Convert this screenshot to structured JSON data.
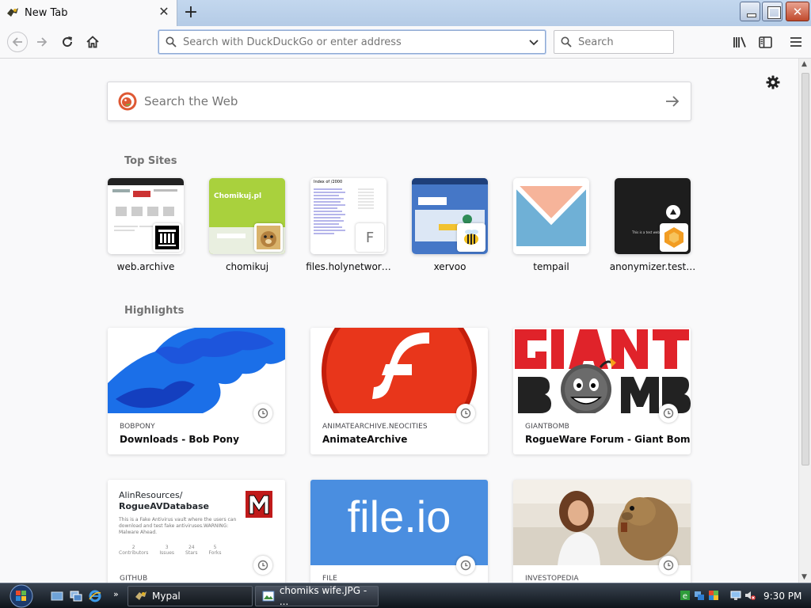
{
  "browser": {
    "tab": {
      "title": "New Tab"
    },
    "urlbar": {
      "placeholder": "Search with DuckDuckGo or enter address"
    },
    "searchbar": {
      "placeholder": "Search"
    }
  },
  "newtab": {
    "web_search": {
      "placeholder": "Search the Web"
    },
    "top_sites": {
      "title": "Top Sites",
      "items": [
        {
          "label": "web.archive",
          "favicon_letter": ""
        },
        {
          "label": "chomikuj",
          "favicon_letter": ""
        },
        {
          "label": "files.holynetwor…",
          "favicon_letter": "F"
        },
        {
          "label": "xervoo",
          "favicon_letter": ""
        },
        {
          "label": "tempail",
          "favicon_letter": ""
        },
        {
          "label": "anonymizer.test…",
          "favicon_letter": ""
        }
      ]
    },
    "highlights": {
      "title": "Highlights",
      "cards": [
        {
          "host": "BOBPONY",
          "title": "Downloads - Bob Pony"
        },
        {
          "host": "ANIMATEARCHIVE.NEOCITIES",
          "title": "AnimateArchive"
        },
        {
          "host": "GIANTBOMB",
          "title": "RogueWare Forum - Giant Bomb"
        },
        {
          "host": "GITHUB",
          "title": "",
          "preview": {
            "heading_line1": "AlinResources/",
            "heading_line2": "RogueAVDatabase",
            "body": "This is a Fake Antivirus vault where the users can download and test fake antiviruses.WARNING: Malware Ahead.",
            "stats": [
              {
                "value": "2",
                "label": "Contributors"
              },
              {
                "value": "3",
                "label": "Issues"
              },
              {
                "value": "24",
                "label": "Stars"
              },
              {
                "value": "5",
                "label": "Forks"
              }
            ]
          }
        },
        {
          "host": "FILE",
          "title": "",
          "preview": {
            "text": "file.io"
          }
        },
        {
          "host": "INVESTOPEDIA",
          "title": ""
        }
      ]
    },
    "thumb_text": {
      "chomikuj_logo": "Chomikuj.pl",
      "archive_header": "Index of /2000",
      "anonymizer_caption": "This is a test website"
    }
  },
  "taskbar": {
    "tasks": [
      {
        "label": "Mypal"
      },
      {
        "label": "chomiks wife.JPG - ..."
      }
    ],
    "clock": "9:30 PM"
  },
  "colors": {
    "accent": "#0a84ff",
    "ddg": "#de5833",
    "flash_red": "#d72d10",
    "giantbomb_red": "#e0232a",
    "fileio_blue": "#4a8ee0"
  }
}
